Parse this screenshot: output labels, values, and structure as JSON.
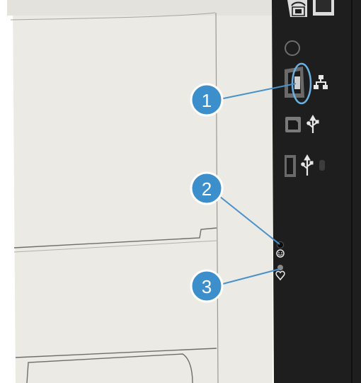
{
  "callouts": [
    {
      "number": "1",
      "target": "network-port"
    },
    {
      "number": "2",
      "target": "wake-light"
    },
    {
      "number": "3",
      "target": "heartbeat-light"
    }
  ],
  "colors": {
    "panel": "#1e1e1e",
    "body": "#ebeae5",
    "callout_fill": "#3d8fcb",
    "callout_ring": "#ffffff",
    "leader": "#4a90c9"
  },
  "icons": [
    "fax-port-icon",
    "network-icon",
    "usb-device-icon",
    "usb-host-icon",
    "wake-icon",
    "heart-icon"
  ]
}
